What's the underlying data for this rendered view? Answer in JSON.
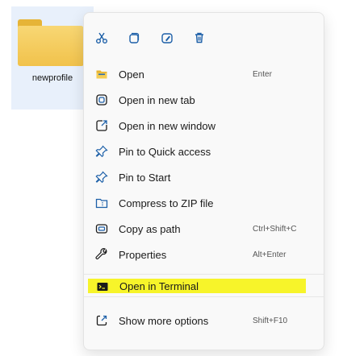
{
  "desktop": {
    "folder_label": "newprofile"
  },
  "quick_actions": [
    {
      "icon": "scissors-icon",
      "name": "cut"
    },
    {
      "icon": "copy-icon",
      "name": "copy"
    },
    {
      "icon": "rename-icon",
      "name": "rename"
    },
    {
      "icon": "trash-icon",
      "name": "delete"
    }
  ],
  "menu": {
    "items": [
      {
        "label": "Open",
        "shortcut": "Enter",
        "icon": "folder-open-icon"
      },
      {
        "label": "Open in new tab",
        "shortcut": "",
        "icon": "new-tab-icon"
      },
      {
        "label": "Open in new window",
        "shortcut": "",
        "icon": "new-window-icon"
      },
      {
        "label": "Pin to Quick access",
        "shortcut": "",
        "icon": "pin-icon"
      },
      {
        "label": "Pin to Start",
        "shortcut": "",
        "icon": "pin-icon"
      },
      {
        "label": "Compress to ZIP file",
        "shortcut": "",
        "icon": "zip-icon"
      },
      {
        "label": "Copy as path",
        "shortcut": "Ctrl+Shift+C",
        "icon": "copy-path-icon"
      },
      {
        "label": "Properties",
        "shortcut": "Alt+Enter",
        "icon": "wrench-icon"
      },
      {
        "label": "Open in Terminal",
        "shortcut": "",
        "icon": "terminal-icon"
      },
      {
        "label": "Show more options",
        "shortcut": "Shift+F10",
        "icon": "more-options-icon"
      }
    ]
  },
  "colors": {
    "highlight": "#f7f42a",
    "accent": "#1c5fa8",
    "folder": "#f1c24b"
  }
}
